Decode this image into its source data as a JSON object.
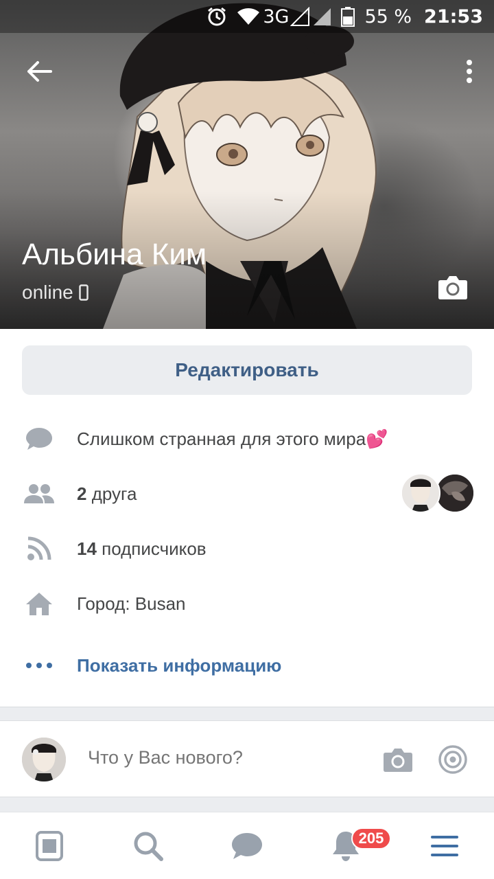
{
  "status_bar": {
    "network": "3G",
    "battery": "55 %",
    "time": "21:53"
  },
  "profile": {
    "name": "Альбина Ким",
    "status": "online"
  },
  "actions": {
    "edit_label": "Редактировать"
  },
  "info": {
    "status_text": "Слишком странная для этого мира💕",
    "friends_count": "2",
    "friends_word": "друга",
    "followers_count": "14",
    "followers_word": "подписчиков",
    "city": "Город: Busan",
    "show_info": "Показать информацию"
  },
  "composer": {
    "placeholder": "Что у Вас нового?"
  },
  "bottom_nav": {
    "notifications_badge": "205"
  },
  "colors": {
    "accent": "#3f6ea3",
    "icon_gray": "#a5abb3",
    "badge": "#ef4b4b"
  }
}
